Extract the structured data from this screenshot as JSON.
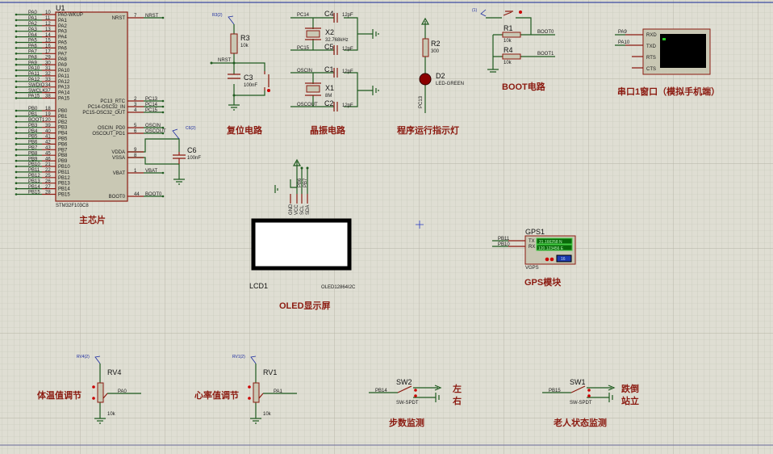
{
  "u1": {
    "ref": "U1",
    "part": "STM32F103C8",
    "left_pins": [
      {
        "name": "PA0-WKUP",
        "num": "10",
        "net": "PA0"
      },
      {
        "name": "PA1",
        "num": "11",
        "net": "PA1"
      },
      {
        "name": "PA2",
        "num": "12",
        "net": "PA2"
      },
      {
        "name": "PA3",
        "num": "13",
        "net": "PA3"
      },
      {
        "name": "PA4",
        "num": "14",
        "net": "PA4"
      },
      {
        "name": "PA5",
        "num": "15",
        "net": "PA5"
      },
      {
        "name": "PA6",
        "num": "16",
        "net": "PA6"
      },
      {
        "name": "PA7",
        "num": "17",
        "net": "PA7"
      },
      {
        "name": "PA8",
        "num": "29",
        "net": "PA8"
      },
      {
        "name": "PA9",
        "num": "30",
        "net": "PA9"
      },
      {
        "name": "PA10",
        "num": "31",
        "net": "PA10"
      },
      {
        "name": "PA11",
        "num": "32",
        "net": "PA11"
      },
      {
        "name": "PA12",
        "num": "33",
        "net": "PA12"
      },
      {
        "name": "PA13",
        "num": "34",
        "net": "SWDIO"
      },
      {
        "name": "PA14",
        "num": "37",
        "net": "SWCLK"
      },
      {
        "name": "PA15",
        "num": "38",
        "net": "PA15"
      },
      {
        "name": "PB0",
        "num": "18",
        "net": "PB0"
      },
      {
        "name": "PB1",
        "num": "19",
        "net": "PB1"
      },
      {
        "name": "PB2",
        "num": "20",
        "net": "BOOT1"
      },
      {
        "name": "PB3",
        "num": "39",
        "net": "PB3"
      },
      {
        "name": "PB4",
        "num": "40",
        "net": "PB4"
      },
      {
        "name": "PB5",
        "num": "41",
        "net": "PB5"
      },
      {
        "name": "PB6",
        "num": "42",
        "net": "PB6"
      },
      {
        "name": "PB7",
        "num": "43",
        "net": "PB7"
      },
      {
        "name": "PB8",
        "num": "45",
        "net": "PB8"
      },
      {
        "name": "PB9",
        "num": "46",
        "net": "PB9"
      },
      {
        "name": "PB10",
        "num": "21",
        "net": "PB10"
      },
      {
        "name": "PB11",
        "num": "22",
        "net": "PB11"
      },
      {
        "name": "PB12",
        "num": "25",
        "net": "PB12"
      },
      {
        "name": "PB13",
        "num": "26",
        "net": "PB13"
      },
      {
        "name": "PB14",
        "num": "27",
        "net": "PB14"
      },
      {
        "name": "PB15",
        "num": "28",
        "net": "PB15"
      }
    ],
    "right_pins": [
      {
        "name": "NRST",
        "num": "7",
        "net": "NRST"
      },
      {
        "name": "PC13_RTC",
        "num": "2",
        "net": "PC13"
      },
      {
        "name": "PC14-OSC32_IN",
        "num": "3",
        "net": "PC14"
      },
      {
        "name": "PC15-OSC32_OUT",
        "num": "4",
        "net": "PC15"
      },
      {
        "name": "OSCIN_PD0",
        "num": "5",
        "net": "OSCIN"
      },
      {
        "name": "OSCOUT_PD1",
        "num": "6",
        "net": "OSCOUT"
      },
      {
        "name": "VDDA",
        "num": "9",
        "net": ""
      },
      {
        "name": "VSSA",
        "num": "8",
        "net": ""
      },
      {
        "name": "VBAT",
        "num": "1",
        "net": "VBAT"
      },
      {
        "name": "BOOT0",
        "num": "44",
        "net": "BOOT0"
      }
    ],
    "c6": {
      "ref": "C6",
      "value": "100nF",
      "probe": "C6(2)"
    },
    "section_title": "主芯片"
  },
  "reset": {
    "probe": "R3(2)",
    "r_ref": "R3",
    "r_val": "10k",
    "net": "NRST",
    "c_ref": "C3",
    "c_val": "100nF",
    "title": "复位电路"
  },
  "crystal": {
    "nets": [
      "PC14",
      "PC15",
      "OSCIN",
      "OSCOUT"
    ],
    "c4": {
      "ref": "C4",
      "val": "12pF"
    },
    "c5": {
      "ref": "C5",
      "val": "12pF"
    },
    "c1": {
      "ref": "C1",
      "val": "12pF"
    },
    "c2": {
      "ref": "C2",
      "val": "12pF"
    },
    "x2": {
      "ref": "X2",
      "val": "32.768kHz"
    },
    "x1": {
      "ref": "X1",
      "val": "8M"
    },
    "title": "晶振电路"
  },
  "led": {
    "r_ref": "R2",
    "r_val": "300",
    "d_ref": "D2",
    "d_val": "LED-GREEN",
    "net": "PC13",
    "title": "程序运行指示灯",
    "led_color": "#8b0000"
  },
  "boot": {
    "probe": "(1)",
    "r1": {
      "ref": "R1",
      "val": "10k"
    },
    "r4": {
      "ref": "R4",
      "val": "10k"
    },
    "net0": "BOOT0",
    "net1": "BOOT1",
    "title": "BOOT电路"
  },
  "uart": {
    "nets": [
      "PA9",
      "PA10"
    ],
    "pins": [
      "RXD",
      "TXD",
      "RTS",
      "CTS"
    ],
    "title": "串口1窗口（模拟手机端）"
  },
  "oled": {
    "pins": [
      "GND",
      "VCC",
      "SCL",
      "SDA"
    ],
    "nets": [
      "PB6",
      "PB7"
    ],
    "ref": "LCD1",
    "part": "OLED12864I2C",
    "title": "OLED显示屏"
  },
  "gps": {
    "ref": "GPS1",
    "part": "VGPS",
    "nets": [
      "PB11",
      "PB10"
    ],
    "pins": [
      "TX",
      "RX"
    ],
    "lat": "31.166258 N",
    "lon": "120.123456 E",
    "count": "16",
    "title": "GPS模块"
  },
  "rv4": {
    "probe": "RV4(2)",
    "ref": "RV4",
    "val": "10k",
    "net": "PA0",
    "title": "体温值调节"
  },
  "rv1": {
    "probe": "RV1(2)",
    "ref": "RV1",
    "val": "10k",
    "net": "PA1",
    "title": "心率值调节"
  },
  "sw2": {
    "ref": "SW2",
    "part": "SW-SPDT",
    "net": "PB14",
    "label_top": "左",
    "label_bottom": "右",
    "title": "步数监测"
  },
  "sw1": {
    "ref": "SW1",
    "part": "SW-SPDT",
    "net": "PB15",
    "label_top": "跌倒",
    "label_bottom": "站立",
    "title": "老人状态监测"
  }
}
